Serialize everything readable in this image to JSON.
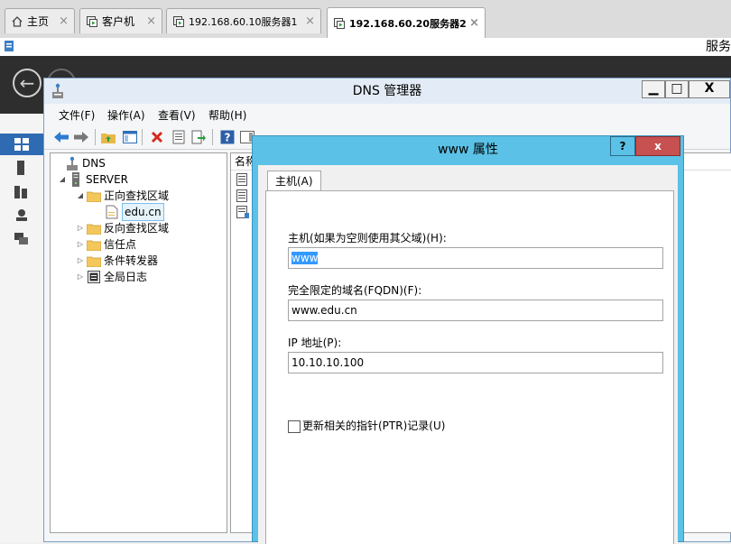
{
  "browser": {
    "tabs": [
      {
        "label": "主页",
        "icon": "home-icon"
      },
      {
        "label": "客户机",
        "icon": "vm-icon"
      },
      {
        "label": "192.168.60.10服务器1",
        "icon": "vm-icon"
      },
      {
        "label": "192.168.60.20服务器2",
        "icon": "vm-icon",
        "active": true
      }
    ],
    "close_glyph": "×"
  },
  "remote": {
    "strip_text": "服务",
    "back_glyph": "←"
  },
  "dns_window": {
    "title": "DNS 管理器",
    "min_glyph": "▁",
    "max_glyph": "□",
    "close_glyph": "X",
    "menu": [
      "文件(F)",
      "操作(A)",
      "查看(V)",
      "帮助(H)"
    ],
    "tree": [
      {
        "label": "DNS",
        "icon": "dns-icon",
        "level": 0,
        "expander": ""
      },
      {
        "label": "SERVER",
        "icon": "server-icon",
        "level": 1,
        "expander": "◢"
      },
      {
        "label": "正向查找区域",
        "icon": "folder-icon",
        "level": 2,
        "expander": "◢"
      },
      {
        "label": "edu.cn",
        "icon": "zone-icon",
        "level": 3,
        "expander": "",
        "selected": true
      },
      {
        "label": "反向查找区域",
        "icon": "folder-icon",
        "level": 2,
        "expander": "▷"
      },
      {
        "label": "信任点",
        "icon": "folder-icon",
        "level": 2,
        "expander": "▷"
      },
      {
        "label": "条件转发器",
        "icon": "folder-icon",
        "level": 2,
        "expander": "▷"
      },
      {
        "label": "全局日志",
        "icon": "log-icon",
        "level": 2,
        "expander": "▷"
      }
    ],
    "list_column": "名称"
  },
  "dialog": {
    "title": "www 属性",
    "help_glyph": "?",
    "close_glyph": "x",
    "tab": "主机(A)",
    "host_label": "主机(如果为空则使用其父域)(H):",
    "host_value": "www",
    "fqdn_label": "完全限定的域名(FQDN)(F):",
    "fqdn_value": "www.edu.cn",
    "ip_label": "IP 地址(P):",
    "ip_value": "10.10.10.100",
    "ptr_label": "更新相关的指针(PTR)记录(U)",
    "ptr_checked": false
  },
  "colors": {
    "dialog_frame": "#5bc1e6",
    "close_red": "#c75050",
    "selection_blue": "#3399ff",
    "nav_selected": "#2f6bb3"
  }
}
